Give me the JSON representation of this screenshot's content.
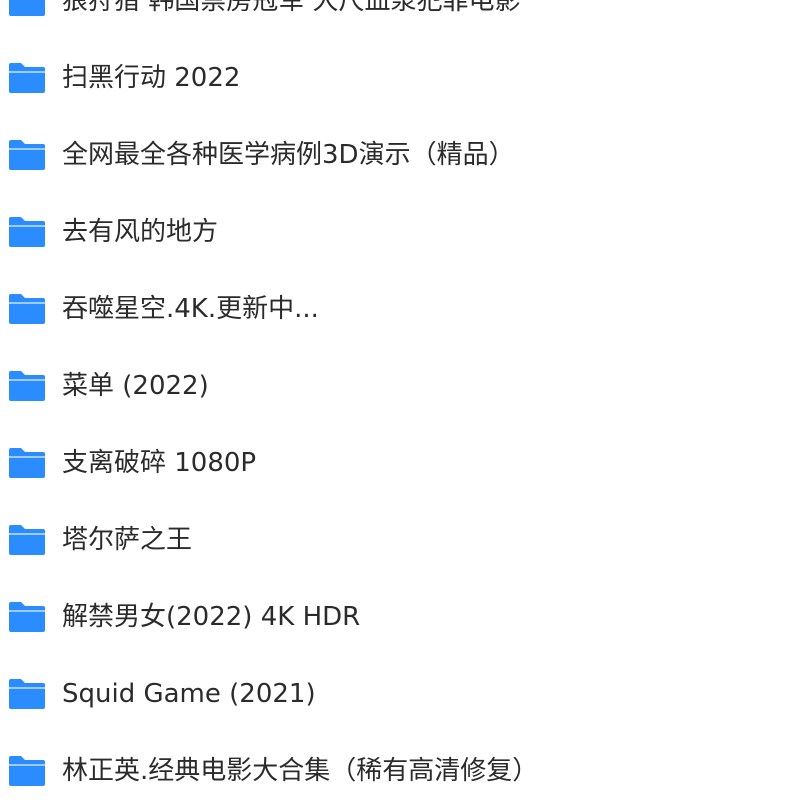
{
  "colors": {
    "folder_icon": "#2b8cff",
    "text": "#2b2b2b",
    "background": "#ffffff"
  },
  "folders": [
    {
      "name": "狼狩猎 韩国禁房冠军 大尺血浆犯罪电影",
      "icon": "folder-icon"
    },
    {
      "name": "扫黑行动 2022",
      "icon": "folder-icon"
    },
    {
      "name": "全网最全各种医学病例3D演示（精品）",
      "icon": "folder-icon"
    },
    {
      "name": "去有风的地方",
      "icon": "folder-icon"
    },
    {
      "name": "吞噬星空.4K.更新中...",
      "icon": "folder-icon"
    },
    {
      "name": "菜单 (2022)",
      "icon": "folder-icon"
    },
    {
      "name": "支离破碎 1080P",
      "icon": "folder-icon"
    },
    {
      "name": "塔尔萨之王",
      "icon": "folder-icon"
    },
    {
      "name": "解禁男女(2022) 4K HDR",
      "icon": "folder-icon"
    },
    {
      "name": "Squid Game (2021)",
      "icon": "folder-icon"
    },
    {
      "name": "林正英.经典电影大合集（稀有高清修复）",
      "icon": "folder-icon"
    }
  ]
}
